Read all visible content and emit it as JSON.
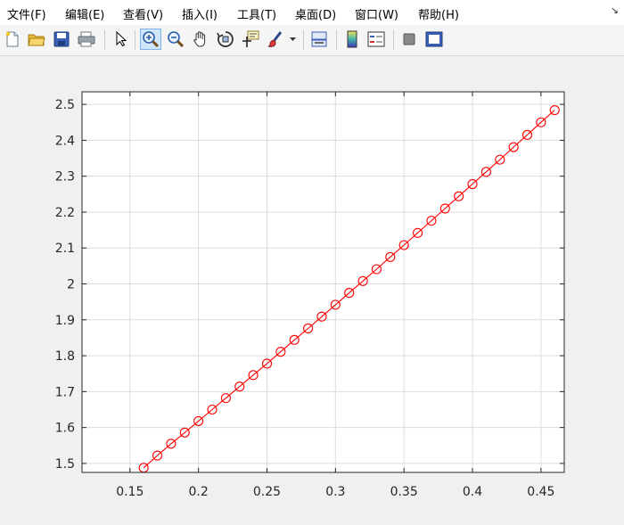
{
  "menu": {
    "items": [
      {
        "label": "文件(F)",
        "accel": "F"
      },
      {
        "label": "编辑(E)",
        "accel": "E"
      },
      {
        "label": "查看(V)",
        "accel": "V"
      },
      {
        "label": "插入(I)",
        "accel": "I"
      },
      {
        "label": "工具(T)",
        "accel": "T"
      },
      {
        "label": "桌面(D)",
        "accel": "D"
      },
      {
        "label": "窗口(W)",
        "accel": "W"
      },
      {
        "label": "帮助(H)",
        "accel": "H"
      }
    ],
    "corner_arrow": "↘"
  },
  "toolbar": {
    "buttons": [
      {
        "name": "new-figure-icon"
      },
      {
        "name": "open-file-icon"
      },
      {
        "name": "save-icon"
      },
      {
        "name": "print-icon"
      },
      {
        "name": "edit-plot-arrow-icon"
      },
      {
        "name": "zoom-in-icon",
        "active": true
      },
      {
        "name": "zoom-out-icon"
      },
      {
        "name": "pan-hand-icon"
      },
      {
        "name": "rotate-3d-icon"
      },
      {
        "name": "data-cursor-icon"
      },
      {
        "name": "brush-icon"
      },
      {
        "name": "brush-dropdown-icon"
      },
      {
        "name": "link-plot-icon"
      },
      {
        "name": "colorbar-icon"
      },
      {
        "name": "legend-icon"
      },
      {
        "name": "hide-plot-tools-icon"
      },
      {
        "name": "show-plot-tools-icon"
      }
    ]
  },
  "chart_data": {
    "type": "line",
    "title": "",
    "xlabel": "",
    "ylabel": "",
    "xlim": [
      0.115,
      0.467
    ],
    "ylim": [
      1.475,
      2.535
    ],
    "xticks": [
      0.15,
      0.2,
      0.25,
      0.3,
      0.35,
      0.4,
      0.45
    ],
    "xtick_labels": [
      "0.15",
      "0.2",
      "0.25",
      "0.3",
      "0.35",
      "0.4",
      "0.45"
    ],
    "yticks": [
      1.5,
      1.6,
      1.7,
      1.8,
      1.9,
      2.0,
      2.1,
      2.2,
      2.3,
      2.4,
      2.5
    ],
    "ytick_labels": [
      "1.5",
      "1.6",
      "1.7",
      "1.8",
      "1.9",
      "2",
      "2.1",
      "2.2",
      "2.3",
      "2.4",
      "2.5"
    ],
    "grid": true,
    "series": [
      {
        "color": "#ff0000",
        "marker": "circle-open",
        "x": [
          0.16,
          0.17,
          0.18,
          0.19,
          0.2,
          0.21,
          0.22,
          0.23,
          0.24,
          0.25,
          0.26,
          0.27,
          0.28,
          0.29,
          0.3,
          0.31,
          0.32,
          0.33,
          0.34,
          0.35,
          0.36,
          0.37,
          0.38,
          0.39,
          0.4,
          0.41,
          0.42,
          0.43,
          0.44,
          0.45,
          0.46
        ],
        "y": [
          1.488,
          1.522,
          1.555,
          1.586,
          1.618,
          1.65,
          1.682,
          1.714,
          1.746,
          1.778,
          1.811,
          1.844,
          1.876,
          1.909,
          1.942,
          1.975,
          2.008,
          2.041,
          2.075,
          2.108,
          2.142,
          2.176,
          2.21,
          2.244,
          2.278,
          2.312,
          2.346,
          2.381,
          2.415,
          2.45,
          2.484
        ]
      }
    ]
  }
}
